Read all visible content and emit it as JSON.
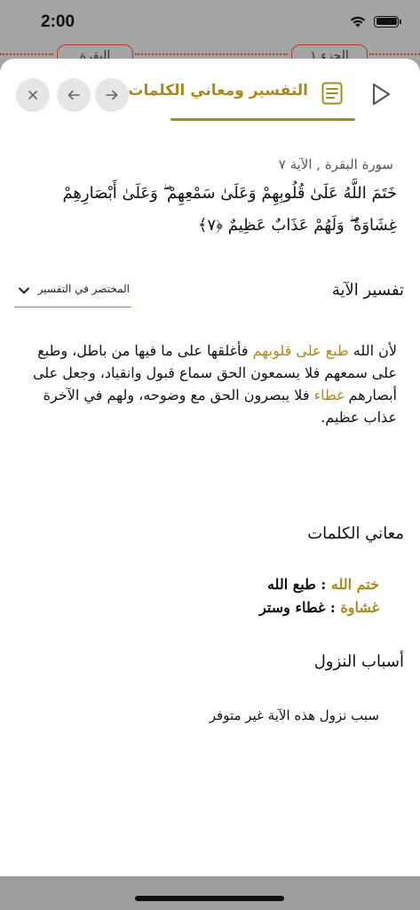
{
  "status_bar": {
    "time": "2:00"
  },
  "background": {
    "pill_left": "البقرة",
    "pill_right": "الجزء ١"
  },
  "toolbar": {
    "close_icon": "close-icon",
    "back_icon": "arrow-left-icon",
    "forward_icon": "arrow-right-icon",
    "tab_label": "التفسير ومعاني الكلمات",
    "tab_icon": "document-lines-icon",
    "play_icon": "play-icon",
    "accent_color": "#a88a1c"
  },
  "ayah": {
    "reference": "سورة البقرة , الآية ٧",
    "text": "خَتَمَ اللَّهُ عَلَىٰ قُلُوبِهِمْ وَعَلَىٰ سَمْعِهِمْ ۖ وَعَلَىٰ أَبْصَارِهِمْ غِشَاوَةٌ ۖ وَلَهُمْ عَذَابٌ عَظِيمٌ ﴿٧﴾"
  },
  "tafsir": {
    "title": "تفسير الآية",
    "selected_source": "المختصر في التفسير",
    "body_part1": "لأن الله ",
    "body_hl1": "طبع على قلوبهم",
    "body_part2": " فأغلقها على ما فيها من باطل، وطبع على سمعهم فلا يسمعون الحق سماع قبول وانقياد، وجعل على أبصارهم ",
    "body_hl2": "غطاء",
    "body_part3": " فلا يبصرون الحق مع وضوحه، ولهم في الآخرة عذاب عظيم."
  },
  "meanings": {
    "title": "معاني الكلمات",
    "items": [
      {
        "word": "ختم الله",
        "sep": " : ",
        "meaning": "طبع الله"
      },
      {
        "word": "غشاوة",
        "sep": " : ",
        "meaning": "غطاء وستر"
      }
    ]
  },
  "asbab": {
    "title": "أسباب النزول",
    "body": "سبب نزول هذه الآية غير متوفر"
  }
}
